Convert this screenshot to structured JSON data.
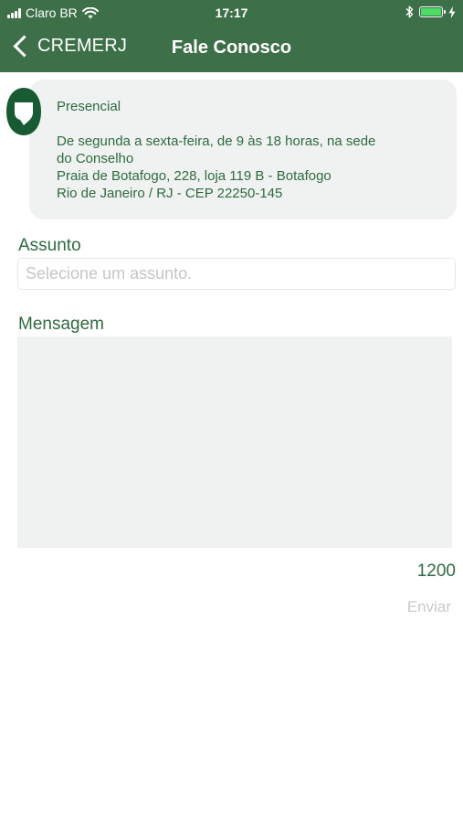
{
  "status_bar": {
    "carrier": "Claro BR",
    "time": "17:17",
    "icons": [
      "signal-bars-icon",
      "wifi-icon",
      "bluetooth-icon",
      "battery-icon",
      "charging-bolt-icon"
    ],
    "battery_level": 1.0,
    "battery_color": "#4cd964"
  },
  "navbar": {
    "back_label": "CREMERJ",
    "title": "Fale Conosco",
    "background": "#3d7048"
  },
  "info_card": {
    "icon": "cremerj-logo-icon",
    "title": "Presencial",
    "lines": [
      "De segunda a sexta-feira, de 9 às 18 horas, na sede",
      "do Conselho",
      "Praia de Botafogo, 228, loja 119 B - Botafogo",
      "Rio de Janeiro / RJ - CEP 22250-145"
    ]
  },
  "form": {
    "subject_label": "Assunto",
    "subject_placeholder": "Selecione um assunto.",
    "message_label": "Mensagem",
    "message_value": "",
    "char_counter": "1200",
    "send_label": "Enviar"
  },
  "colors": {
    "accent": "#2f6a40",
    "card_bg": "#eff2f1",
    "disabled_text": "#c6cac8"
  }
}
